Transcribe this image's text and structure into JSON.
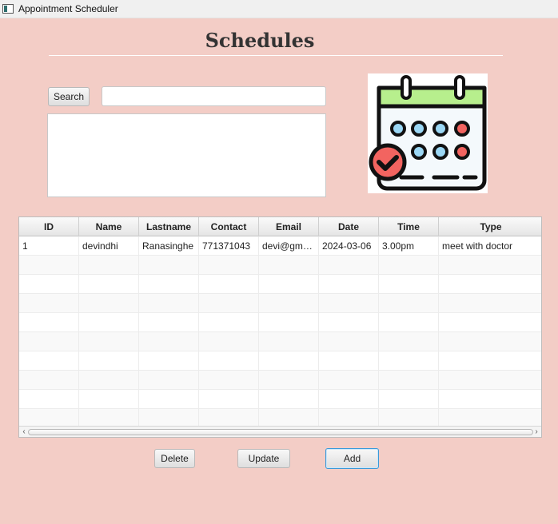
{
  "window": {
    "title": "Appointment Scheduler"
  },
  "header": {
    "title": "Schedules"
  },
  "search": {
    "button_label": "Search",
    "input_value": "",
    "placeholder": ""
  },
  "image": {
    "icon": "calendar-check-icon"
  },
  "table": {
    "columns": [
      "ID",
      "Name",
      "Lastname",
      "Contact",
      "Email",
      "Date",
      "Time",
      "Type"
    ],
    "rows": [
      [
        "1",
        "devindhi",
        "Ranasinghe",
        "771371043",
        "devi@gma...",
        "2024-03-06",
        "3.00pm",
        "meet with doctor"
      ],
      [
        "",
        "",
        "",
        "",
        "",
        "",
        "",
        ""
      ],
      [
        "",
        "",
        "",
        "",
        "",
        "",
        "",
        ""
      ],
      [
        "",
        "",
        "",
        "",
        "",
        "",
        "",
        ""
      ],
      [
        "",
        "",
        "",
        "",
        "",
        "",
        "",
        ""
      ],
      [
        "",
        "",
        "",
        "",
        "",
        "",
        "",
        ""
      ],
      [
        "",
        "",
        "",
        "",
        "",
        "",
        "",
        ""
      ],
      [
        "",
        "",
        "",
        "",
        "",
        "",
        "",
        ""
      ],
      [
        "",
        "",
        "",
        "",
        "",
        "",
        "",
        ""
      ],
      [
        "",
        "",
        "",
        "",
        "",
        "",
        "",
        ""
      ]
    ]
  },
  "actions": {
    "delete": "Delete",
    "update": "Update",
    "add": "Add"
  },
  "colors": {
    "background": "#f3cdc6",
    "button_focus": "#3a9ad9",
    "calendar_green": "#b7ef8d",
    "calendar_blue": "#9bd7f4",
    "calendar_red": "#f26460"
  }
}
